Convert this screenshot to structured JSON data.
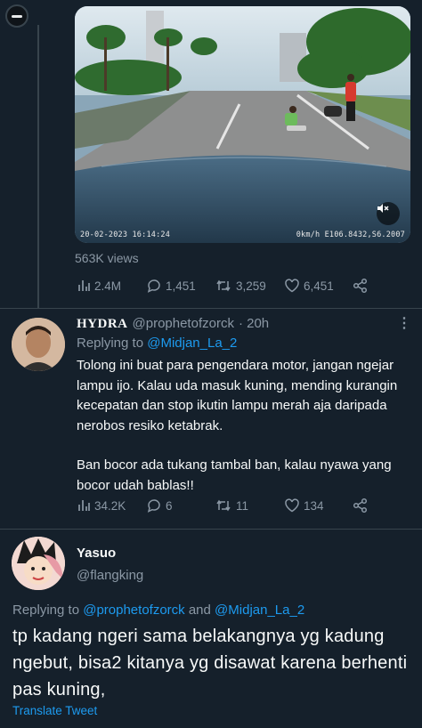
{
  "colors": {
    "background": "#15202b",
    "text": "#f7f9f9",
    "muted": "#8b98a5",
    "accent": "#1d9bf0",
    "divider": "#38444d"
  },
  "top_avatar": {
    "icon": "minus-icon"
  },
  "video": {
    "timestamp": "20-02-2023 16:14:24",
    "gps": "0km/h E106.8432,S6.2007",
    "mute_icon": "speaker-muted-icon"
  },
  "main_tweet": {
    "views": "563K views",
    "stats": {
      "views": "2.4M",
      "replies": "1,451",
      "retweets": "3,259",
      "likes": "6,451"
    }
  },
  "reply1": {
    "name": "HYDRA",
    "handle": "@prophetofzorck",
    "time": "· 20h",
    "replying_prefix": "Replying to",
    "replying_to": "@Midjan_La_2",
    "text_p1": "Tolong ini buat para pengendara motor, jangan ngejar lampu ijo. Kalau uda masuk kuning, mending kurangin kecepatan dan stop ikutin lampu merah aja daripada nerobos resiko ketabrak.",
    "text_p2": "Ban bocor ada tukang tambal ban, kalau nyawa yang bocor udah bablas!!",
    "stats": {
      "views": "34.2K",
      "replies": "6",
      "retweets": "11",
      "likes": "134"
    }
  },
  "reply2": {
    "name": "Yasuo",
    "handle": "@flangking",
    "replying_prefix": "Replying to",
    "replying_to_1": "@prophetofzorck",
    "replying_and": "and",
    "replying_to_2": "@Midjan_La_2",
    "text": "tp kadang ngeri sama belakangnya yg kadung ngebut, bisa2 kitanya yg disawat karena berhenti pas kuning,",
    "translate": "Translate Tweet"
  }
}
